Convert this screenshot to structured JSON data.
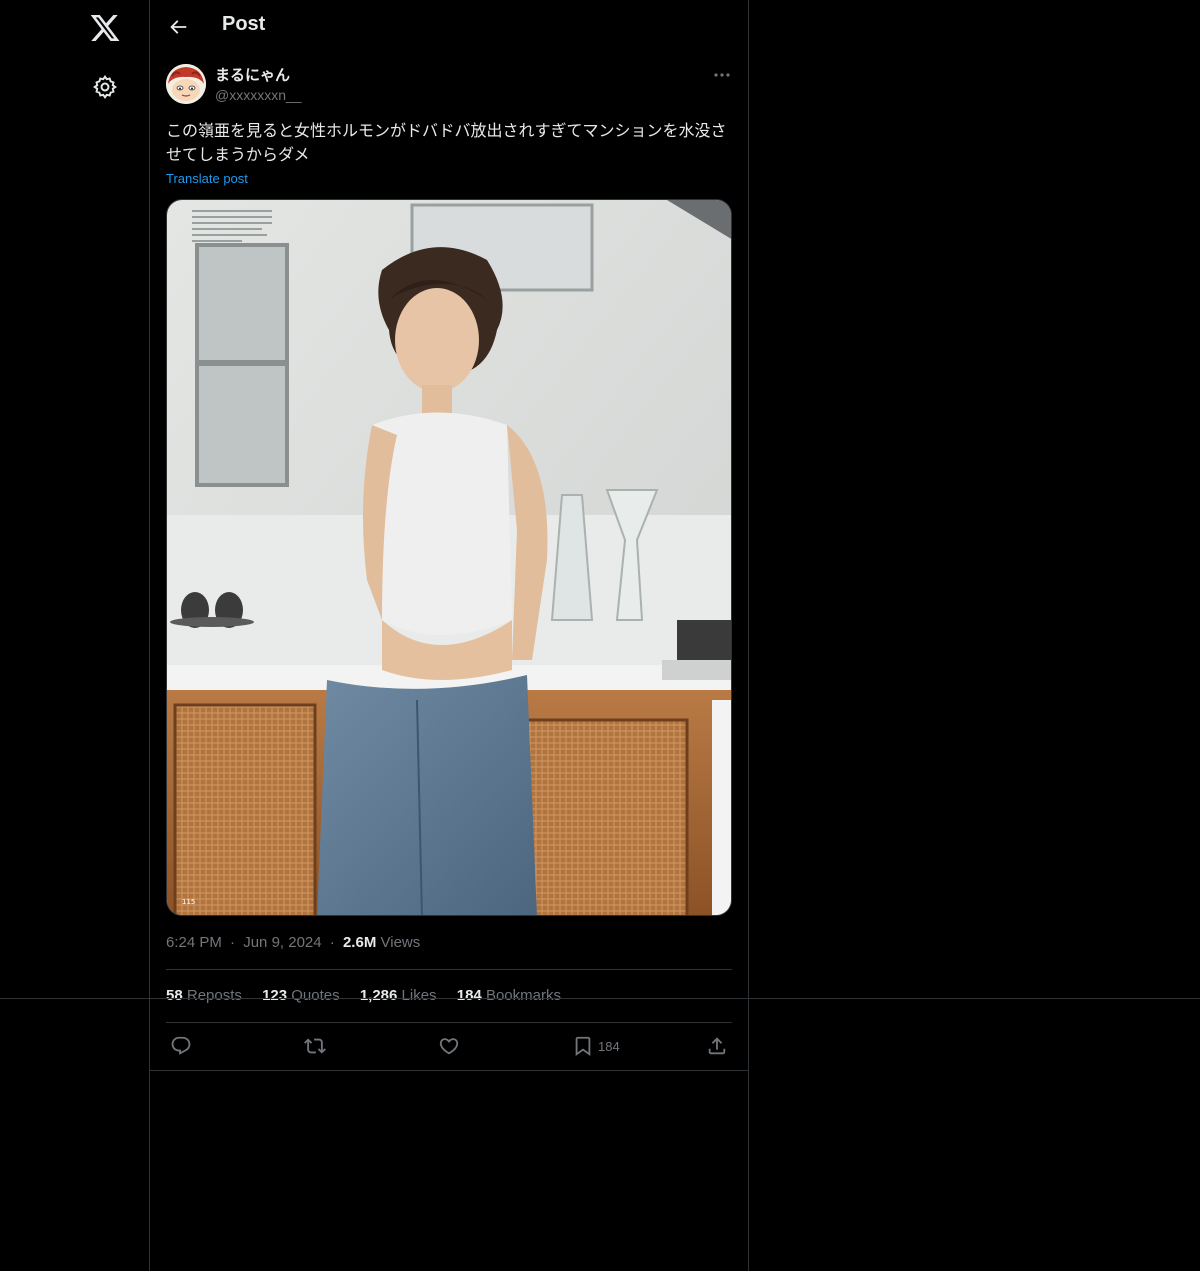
{
  "header": {
    "title": "Post"
  },
  "author": {
    "name": "まるにゃん",
    "handle": "@xxxxxxxn__"
  },
  "post": {
    "text": "この嶺亜を見ると女性ホルモンがドバドバ放出されすぎてマンションを水没させてしまうからダメ",
    "translate_label": "Translate post"
  },
  "media": {
    "page_number": "115"
  },
  "meta": {
    "time": "6:24 PM",
    "date": "Jun 9, 2024",
    "views_count": "2.6M",
    "views_label": "Views",
    "dot": "·"
  },
  "stats": {
    "reposts_count": "58",
    "reposts_label": "Reposts",
    "quotes_count": "123",
    "quotes_label": "Quotes",
    "likes_count": "1,286",
    "likes_label": "Likes",
    "bookmarks_count": "184",
    "bookmarks_label": "Bookmarks"
  },
  "actions": {
    "bookmark_count": "184"
  },
  "icons": [
    "x-logo-icon",
    "gear-icon",
    "back-arrow-icon",
    "more-icon",
    "reply-icon",
    "repost-icon",
    "like-icon",
    "bookmark-icon",
    "share-icon"
  ],
  "colors": {
    "background": "#000000",
    "text": "#e7e9ea",
    "secondary": "#71767b",
    "link": "#1d9bf0",
    "border": "#2f3336"
  }
}
